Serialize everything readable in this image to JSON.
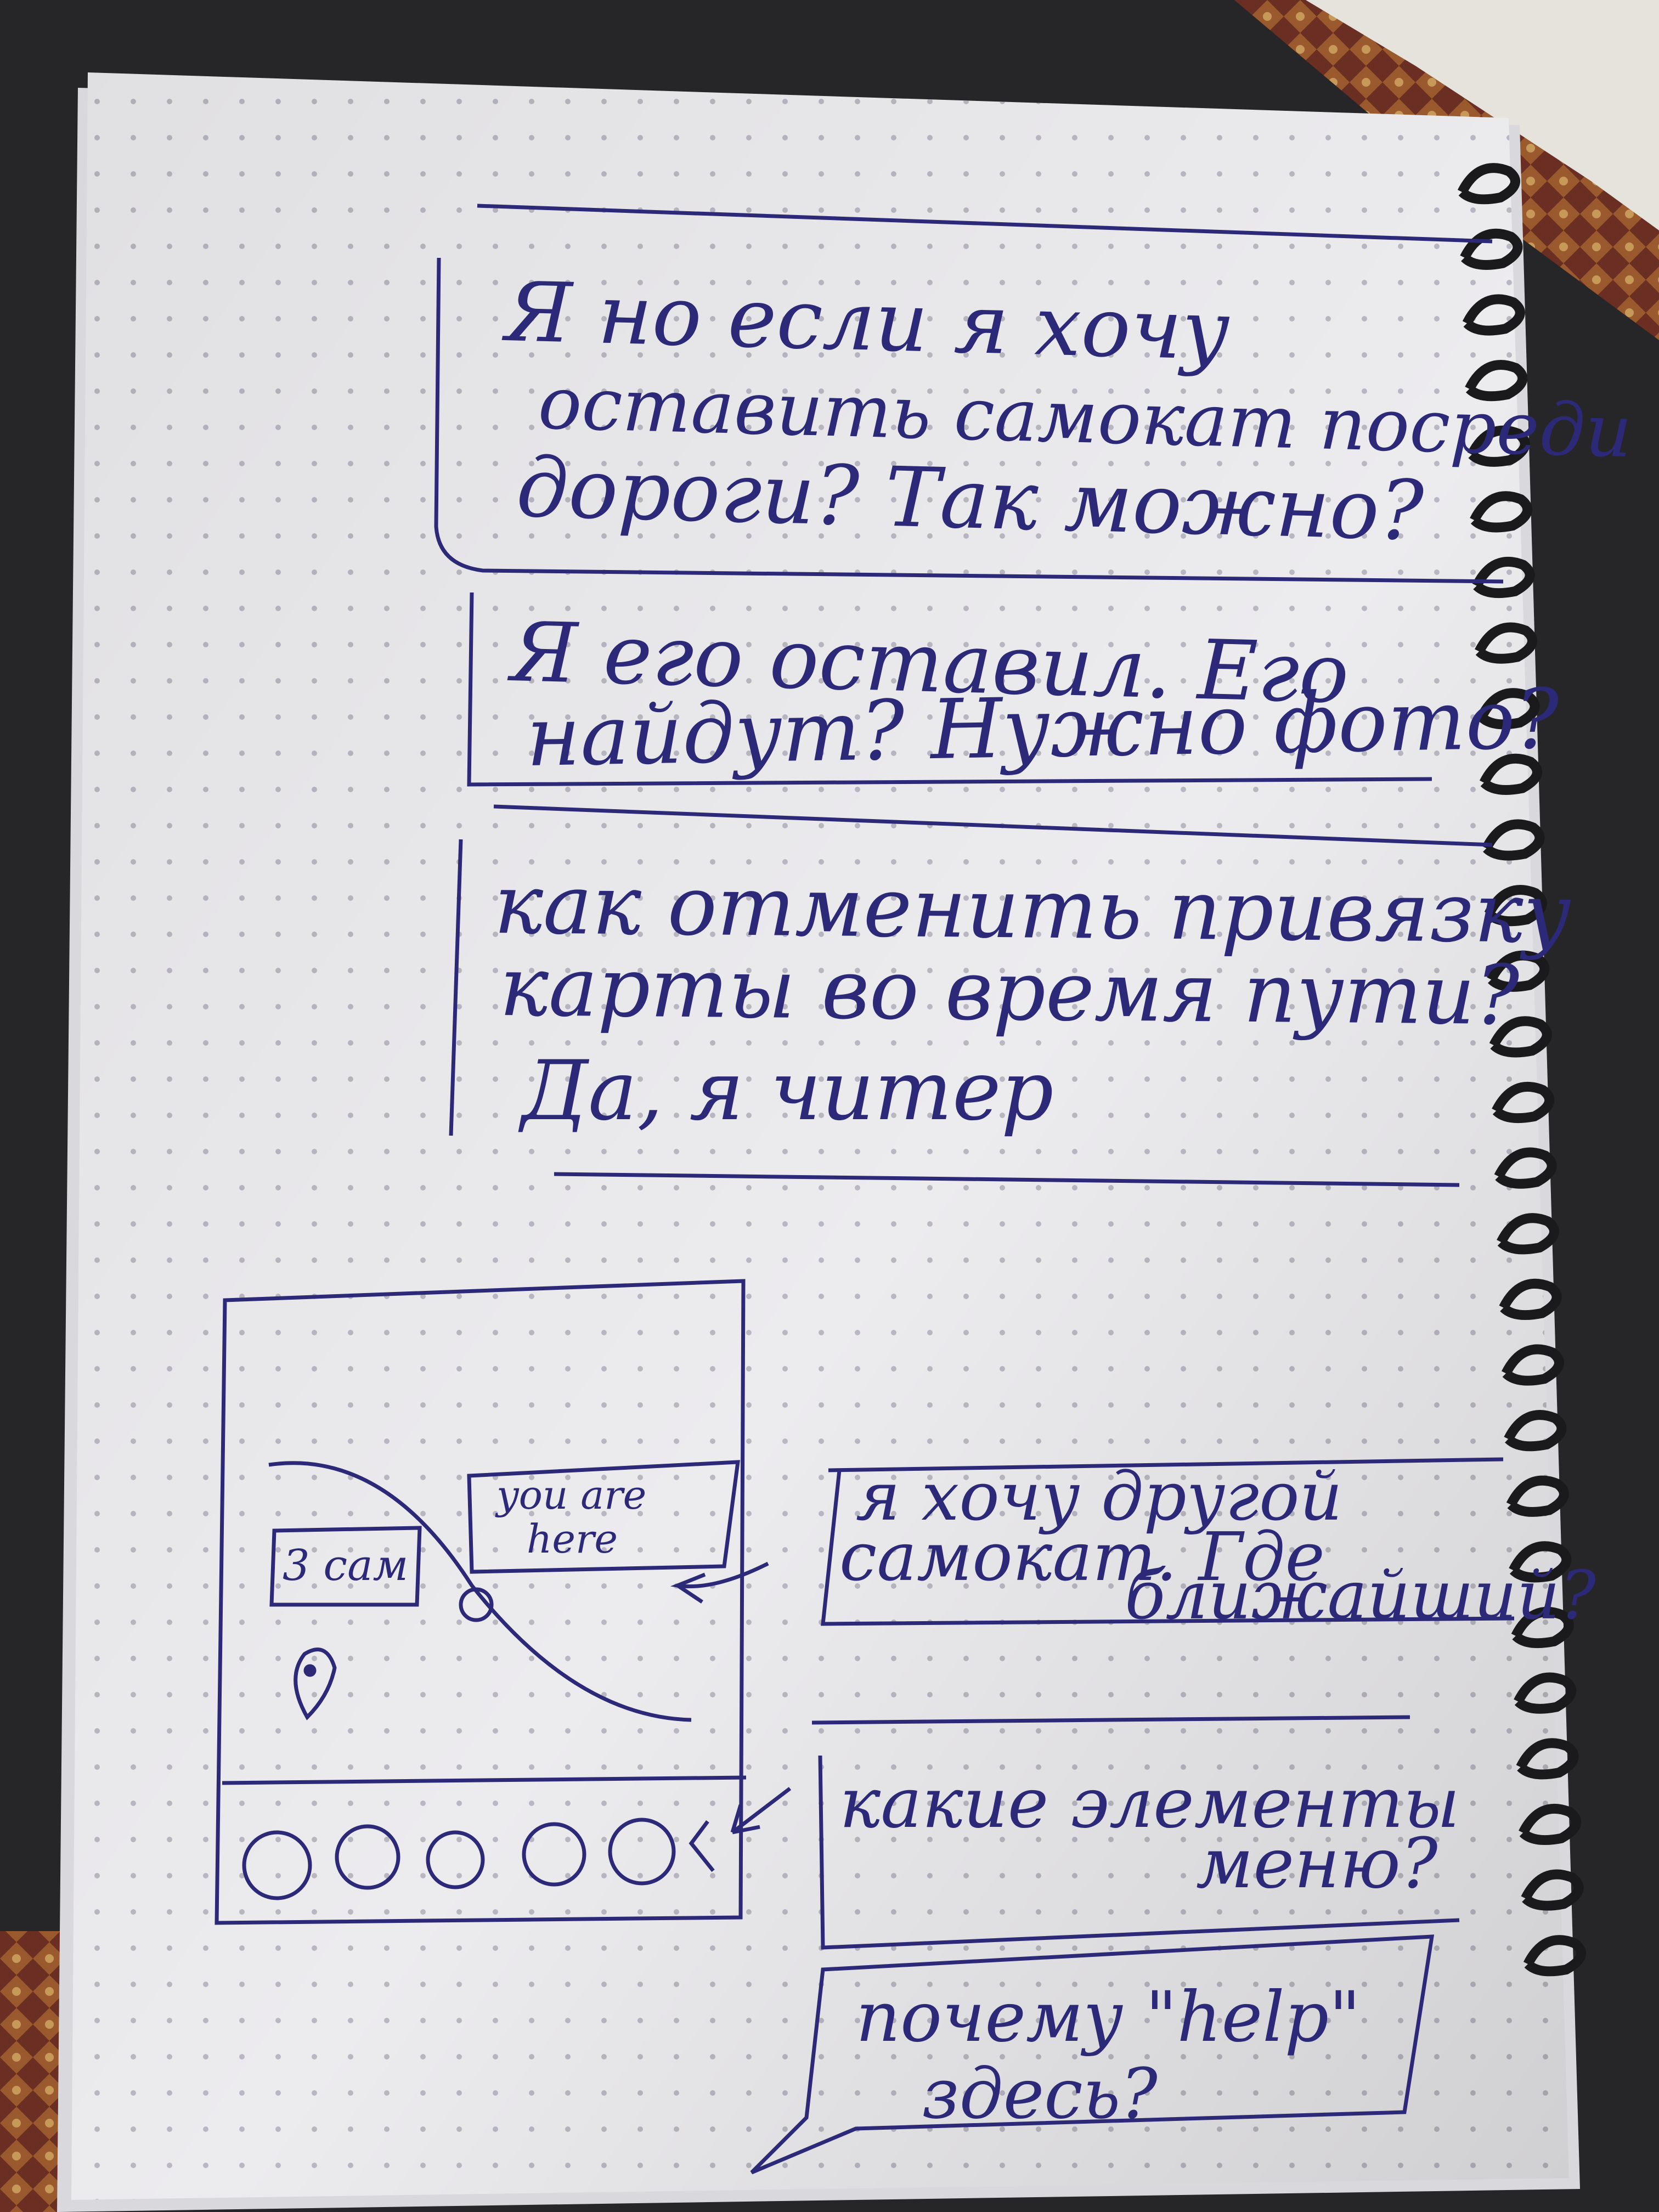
{
  "colors": {
    "paper": "#ecebee",
    "ink": "#2c2a78",
    "dots": "#b9b8c2",
    "spiral": "#1a1a1c",
    "desk": "#2a2a2c",
    "carpet": "#7a3a2a"
  },
  "notes": [
    {
      "lines": [
        "Я но если я хочу",
        "оставить самокат посреди",
        "дороги? Так можно?"
      ]
    },
    {
      "lines": [
        "Я его оставил. Его",
        "найдут? Нужно фото?"
      ]
    },
    {
      "lines": [
        "как отменить привязку",
        "карты во время пути?",
        "Да, я читер"
      ]
    }
  ],
  "sketch": {
    "label_scooter": "3 сам",
    "label_location": [
      "you are",
      "here"
    ],
    "icons": [
      "circle-icon",
      "circle-icon",
      "circle-icon",
      "circle-icon",
      "circle-icon",
      "circle-icon"
    ]
  },
  "side_notes": [
    {
      "lines": [
        "я хочу другой",
        "самокат. Где",
        "ближайший?"
      ]
    },
    {
      "lines": [
        "какие элементы",
        "меню?"
      ]
    },
    {
      "lines": [
        "почему \"help\"",
        "здесь?"
      ]
    }
  ]
}
